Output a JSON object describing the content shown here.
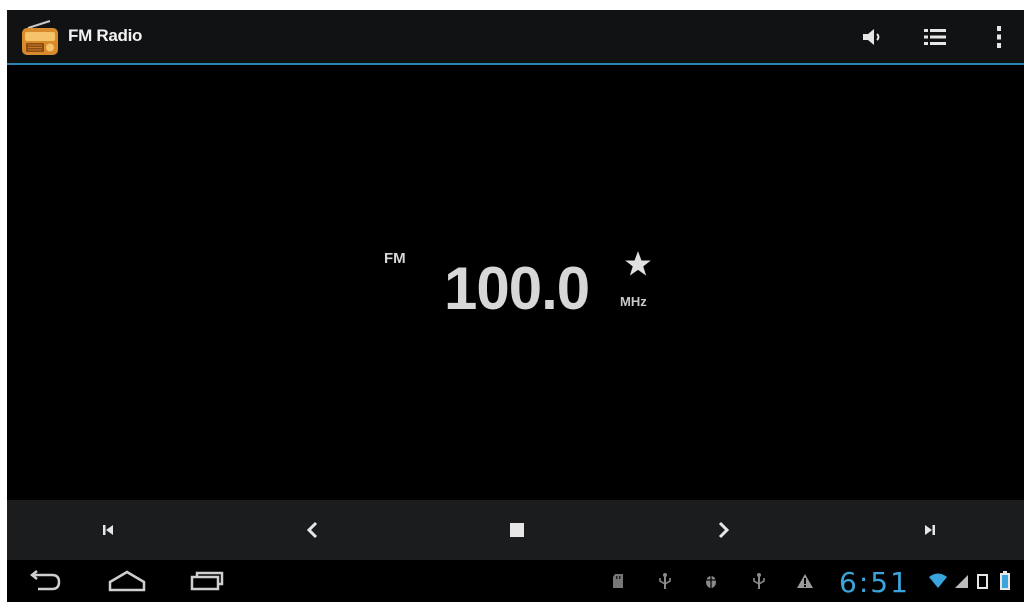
{
  "app": {
    "title": "FM Radio",
    "icon": "radio-icon",
    "accent": "#2b84ad",
    "actions": [
      "speaker-icon",
      "list-icon",
      "overflow-menu-icon"
    ]
  },
  "tuner": {
    "band": "FM",
    "frequency": "100.0",
    "unit": "MHz",
    "favorite_icon": "star-icon"
  },
  "controls": [
    "skip-previous-icon",
    "seek-back-icon",
    "stop-icon",
    "seek-forward-icon",
    "skip-next-icon"
  ],
  "system_bar": {
    "nav": [
      "back-icon",
      "home-icon",
      "recent-apps-icon"
    ],
    "status_icons": [
      "sd-card-icon",
      "usb-icon",
      "usb-debug-icon",
      "usb-icon",
      "warning-icon",
      "wifi-icon",
      "signal-icon",
      "battery-icon"
    ],
    "time": "6:51",
    "clock_color": "#3aa4dc"
  }
}
